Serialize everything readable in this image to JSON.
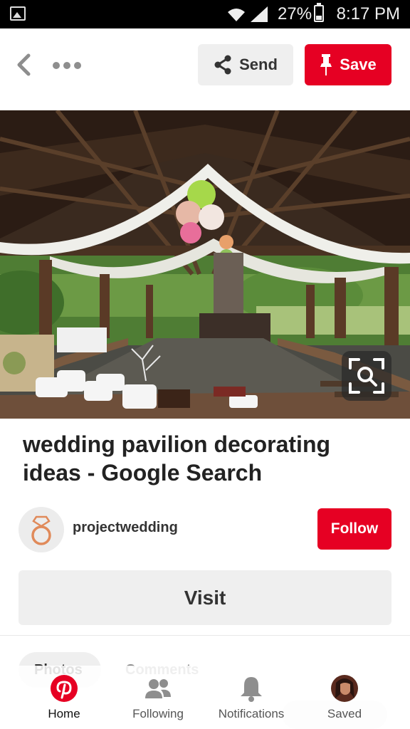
{
  "status_bar": {
    "battery_percent": "27%",
    "time": "8:17 PM",
    "icons": [
      "gallery-icon",
      "wifi-icon",
      "signal-icon",
      "battery-icon"
    ]
  },
  "header": {
    "icons": [
      "back-arrow-icon",
      "more-dots-icon"
    ],
    "send_label": "Send",
    "save_label": "Save"
  },
  "pin": {
    "image_icon": "visual-search-icon",
    "title": "wedding pavilion decorating ideas - Google Search"
  },
  "author": {
    "avatar_icon": "ring-icon",
    "name": "projectwedding",
    "follow_label": "Follow"
  },
  "visit_label": "Visit",
  "tabs": {
    "photos": "Photos",
    "comments": "Comments"
  },
  "bottom_nav": {
    "items": [
      {
        "label": "Home",
        "icon": "pinterest-logo-icon",
        "active": true
      },
      {
        "label": "Following",
        "icon": "people-icon",
        "active": false
      },
      {
        "label": "Notifications",
        "icon": "bell-icon",
        "active": false
      },
      {
        "label": "Saved",
        "icon": "profile-photo-icon",
        "active": false
      }
    ]
  },
  "colors": {
    "brand_red": "#e60023",
    "button_gray": "#efefef",
    "text_dark": "#222222"
  }
}
